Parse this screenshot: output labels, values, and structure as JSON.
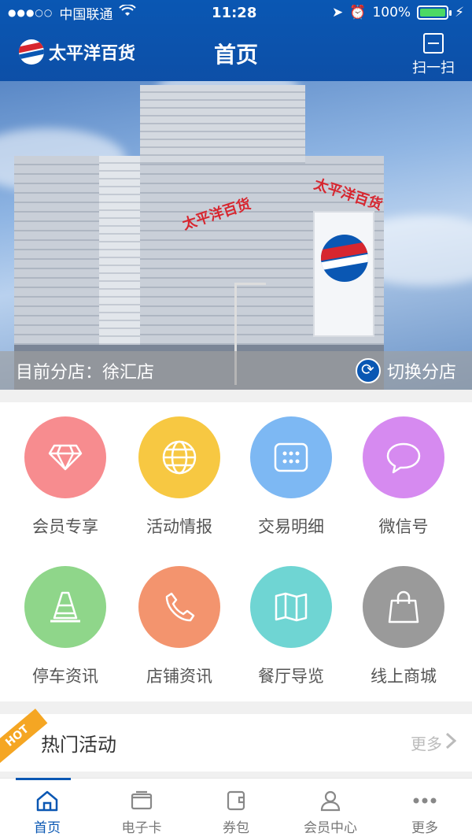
{
  "status": {
    "carrier": "中国联通",
    "time": "11:28",
    "battery": "100%"
  },
  "header": {
    "brand": "太平洋百货",
    "title": "首页",
    "scan_label": "扫一扫"
  },
  "hero": {
    "building_tags": [
      "太平洋百货",
      "太平洋百货"
    ],
    "branch_text": "目前分店：徐汇店",
    "switch_label": "切换分店"
  },
  "menu": [
    {
      "label": "会员专享",
      "icon": "diamond-icon",
      "color": "#f78c8f"
    },
    {
      "label": "活动情报",
      "icon": "globe-icon",
      "color": "#f7c842"
    },
    {
      "label": "交易明细",
      "icon": "keypad-icon",
      "color": "#7db8f3"
    },
    {
      "label": "微信号",
      "icon": "chat-bubble-icon",
      "color": "#d68af0"
    },
    {
      "label": "停车资讯",
      "icon": "traffic-cone-icon",
      "color": "#8fd68a"
    },
    {
      "label": "店铺资讯",
      "icon": "phone-icon",
      "color": "#f3946e"
    },
    {
      "label": "餐厅导览",
      "icon": "map-icon",
      "color": "#6fd5d3"
    },
    {
      "label": "线上商城",
      "icon": "shopping-bag-icon",
      "color": "#9a9a9a"
    }
  ],
  "hot": {
    "badge": "HOT",
    "title": "热门活动",
    "more": "更多"
  },
  "tabs": [
    {
      "label": "首页",
      "icon": "home-icon",
      "active": true
    },
    {
      "label": "电子卡",
      "icon": "card-icon",
      "active": false
    },
    {
      "label": "券包",
      "icon": "wallet-icon",
      "active": false
    },
    {
      "label": "会员中心",
      "icon": "user-icon",
      "active": false
    },
    {
      "label": "更多",
      "icon": "more-dots-icon",
      "active": false
    }
  ],
  "colors": {
    "primary": "#0a57b3",
    "brand_red": "#d7262f",
    "hot_orange": "#f5a623"
  }
}
